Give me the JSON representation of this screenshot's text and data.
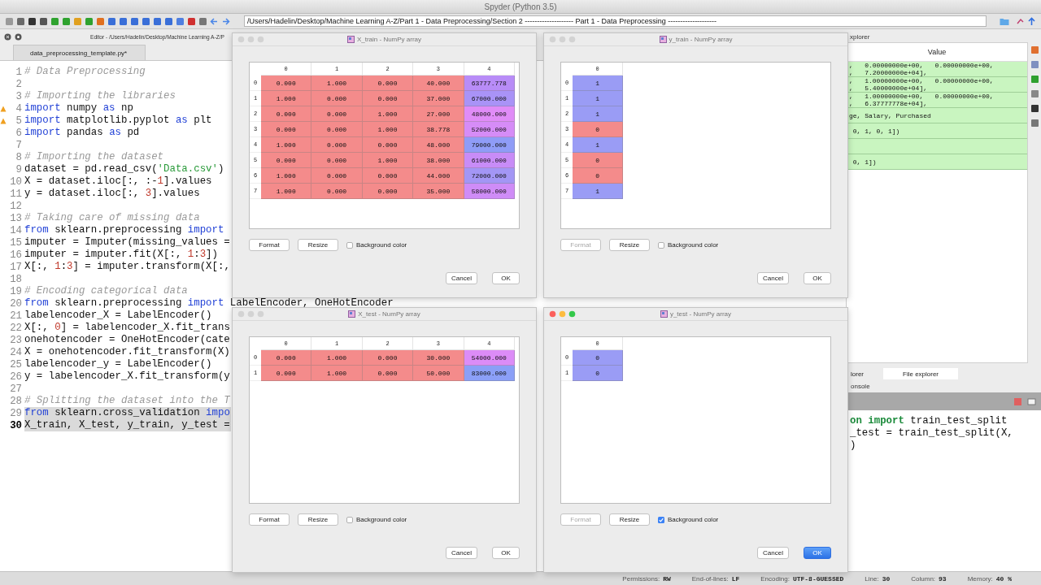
{
  "app": {
    "title": "Spyder (Python 3.5)",
    "path": "/Users/Hadelin/Desktop/Machine Learning A-Z/Part 1 - Data Preprocessing/Section 2 -------------------- Part 1 - Data Preprocessing --------------------"
  },
  "editor": {
    "header": "Editor - /Users/Hadelin/Desktop/Machine Learning A-Z/P",
    "tab": "data_preprocessing_template.py*",
    "lines": [
      {
        "number": "1",
        "warning": false,
        "highlighted": false,
        "current": false,
        "segments": [
          {
            "text": "# Data Preprocessing",
            "kind": "comment"
          }
        ]
      },
      {
        "number": "2",
        "warning": false,
        "highlighted": false,
        "current": false
      },
      {
        "number": "3",
        "warning": false,
        "highlighted": false,
        "current": false,
        "segments": [
          {
            "text": "# Importing the libraries",
            "kind": "comment"
          }
        ]
      },
      {
        "number": "4",
        "warning": true,
        "highlighted": false,
        "current": false,
        "segments": [
          {
            "text": "import",
            "kind": "keyword"
          },
          {
            "text": " numpy ",
            "kind": "plain"
          },
          {
            "text": "as",
            "kind": "keyword"
          },
          {
            "text": " np",
            "kind": "plain"
          }
        ]
      },
      {
        "number": "5",
        "warning": true,
        "highlighted": false,
        "current": false,
        "segments": [
          {
            "text": "import",
            "kind": "keyword"
          },
          {
            "text": " matplotlib.pyplot ",
            "kind": "plain"
          },
          {
            "text": "as",
            "kind": "keyword"
          },
          {
            "text": " plt",
            "kind": "plain"
          }
        ]
      },
      {
        "number": "6",
        "warning": false,
        "highlighted": false,
        "current": false,
        "segments": [
          {
            "text": "import",
            "kind": "keyword"
          },
          {
            "text": " pandas ",
            "kind": "plain"
          },
          {
            "text": "as",
            "kind": "keyword"
          },
          {
            "text": " pd",
            "kind": "plain"
          }
        ]
      },
      {
        "number": "7",
        "warning": false,
        "highlighted": false,
        "current": false
      },
      {
        "number": "8",
        "warning": false,
        "highlighted": false,
        "current": false,
        "segments": [
          {
            "text": "# Importing the dataset",
            "kind": "comment"
          }
        ]
      },
      {
        "number": "9",
        "warning": false,
        "highlighted": false,
        "current": false,
        "segments": [
          {
            "text": "dataset = pd.read_csv(",
            "kind": "plain"
          },
          {
            "text": "'Data.csv'",
            "kind": "string"
          },
          {
            "text": ")",
            "kind": "plain"
          }
        ]
      },
      {
        "number": "10",
        "warning": false,
        "highlighted": false,
        "current": false,
        "segments": [
          {
            "text": "X = dataset.iloc[:, :-",
            "kind": "plain"
          },
          {
            "text": "1",
            "kind": "number"
          },
          {
            "text": "].values",
            "kind": "plain"
          }
        ]
      },
      {
        "number": "11",
        "warning": false,
        "highlighted": false,
        "current": false,
        "segments": [
          {
            "text": "y = dataset.iloc[:, ",
            "kind": "plain"
          },
          {
            "text": "3",
            "kind": "number"
          },
          {
            "text": "].values",
            "kind": "plain"
          }
        ]
      },
      {
        "number": "12",
        "warning": false,
        "highlighted": false,
        "current": false
      },
      {
        "number": "13",
        "warning": false,
        "highlighted": false,
        "current": false,
        "segments": [
          {
            "text": "# Taking care of missing data",
            "kind": "comment"
          }
        ]
      },
      {
        "number": "14",
        "warning": false,
        "highlighted": false,
        "current": false,
        "segments": [
          {
            "text": "from",
            "kind": "keyword"
          },
          {
            "text": " sklearn.preprocessing ",
            "kind": "plain"
          },
          {
            "text": "import",
            "kind": "keyword"
          }
        ]
      },
      {
        "number": "15",
        "warning": false,
        "highlighted": false,
        "current": false,
        "segments": [
          {
            "text": "imputer = Imputer(missing_values =",
            "kind": "plain"
          }
        ]
      },
      {
        "number": "16",
        "warning": false,
        "highlighted": false,
        "current": false,
        "segments": [
          {
            "text": "imputer = imputer.fit(X[:, ",
            "kind": "plain"
          },
          {
            "text": "1",
            "kind": "number"
          },
          {
            "text": ":",
            "kind": "plain"
          },
          {
            "text": "3",
            "kind": "number"
          },
          {
            "text": "])",
            "kind": "plain"
          }
        ]
      },
      {
        "number": "17",
        "warning": false,
        "highlighted": false,
        "current": false,
        "segments": [
          {
            "text": "X[:, ",
            "kind": "plain"
          },
          {
            "text": "1",
            "kind": "number"
          },
          {
            "text": ":",
            "kind": "plain"
          },
          {
            "text": "3",
            "kind": "number"
          },
          {
            "text": "] = imputer.transform(X[:,",
            "kind": "plain"
          }
        ]
      },
      {
        "number": "18",
        "warning": false,
        "highlighted": false,
        "current": false
      },
      {
        "number": "19",
        "warning": false,
        "highlighted": false,
        "current": false,
        "segments": [
          {
            "text": "# Encoding categorical data",
            "kind": "comment"
          }
        ]
      },
      {
        "number": "20",
        "warning": false,
        "highlighted": false,
        "current": false,
        "segments": [
          {
            "text": "from",
            "kind": "keyword"
          },
          {
            "text": " sklearn.preprocessing ",
            "kind": "plain"
          },
          {
            "text": "import",
            "kind": "keyword"
          },
          {
            "text": " LabelEncoder, OneHotEncoder",
            "kind": "plain"
          }
        ]
      },
      {
        "number": "21",
        "warning": false,
        "highlighted": false,
        "current": false,
        "segments": [
          {
            "text": "labelencoder_X = LabelEncoder()",
            "kind": "plain"
          }
        ]
      },
      {
        "number": "22",
        "warning": false,
        "highlighted": false,
        "current": false,
        "segments": [
          {
            "text": "X[:, ",
            "kind": "plain"
          },
          {
            "text": "0",
            "kind": "number"
          },
          {
            "text": "] = labelencoder_X.fit_trans",
            "kind": "plain"
          }
        ]
      },
      {
        "number": "23",
        "warning": false,
        "highlighted": false,
        "current": false,
        "segments": [
          {
            "text": "onehotencoder = OneHotEncoder(cate",
            "kind": "plain"
          }
        ]
      },
      {
        "number": "24",
        "warning": false,
        "highlighted": false,
        "current": false,
        "segments": [
          {
            "text": "X = onehotencoder.fit_transform(X)",
            "kind": "plain"
          }
        ]
      },
      {
        "number": "25",
        "warning": false,
        "highlighted": false,
        "current": false,
        "segments": [
          {
            "text": "labelencoder_y = LabelEncoder()",
            "kind": "plain"
          }
        ]
      },
      {
        "number": "26",
        "warning": false,
        "highlighted": false,
        "current": false,
        "segments": [
          {
            "text": "y = labelencoder_X.fit_transform(y",
            "kind": "plain"
          }
        ]
      },
      {
        "number": "27",
        "warning": false,
        "highlighted": false,
        "current": false
      },
      {
        "number": "28",
        "warning": false,
        "highlighted": false,
        "current": false,
        "segments": [
          {
            "text": "# Splitting the dataset into the T",
            "kind": "comment"
          }
        ]
      },
      {
        "number": "29",
        "warning": false,
        "highlighted": true,
        "current": false,
        "segments": [
          {
            "text": "from",
            "kind": "keyword"
          },
          {
            "text": " sklearn.cross_validation ",
            "kind": "plain"
          },
          {
            "text": "impo",
            "kind": "keyword"
          }
        ]
      },
      {
        "number": "30",
        "warning": false,
        "highlighted": true,
        "current": true,
        "segments": [
          {
            "text": "X_train, X_test, y_train, y_test =",
            "kind": "plain"
          }
        ]
      }
    ]
  },
  "variable_explorer": {
    "header": "xplorer",
    "column": "Value",
    "rows": [
      {
        "lines": [
          ",   0.00000000e+00,   0.00000000e+00,",
          ",   7.20000000e+04],"
        ]
      },
      {
        "lines": [
          ",   1.00000000e+00,   0.00000000e+00,",
          ",   5.40000000e+04],"
        ]
      },
      {
        "lines": [
          ",   1.00000000e+00,   0.00000000e+00,",
          ",   6.37777778e+04],"
        ]
      },
      {
        "lines": [
          "ge, Salary, Purchased"
        ]
      },
      {
        "lines": [
          " 0, 1, 0, 1])"
        ]
      },
      {},
      {
        "lines": [
          " 0, 1])"
        ]
      }
    ]
  },
  "bottom_tabs": [
    {
      "label": "lorer",
      "selected": false
    },
    {
      "label": "File explorer",
      "selected": true
    }
  ],
  "console": {
    "header": "onsole",
    "lines": [
      {
        "segments": [
          {
            "text": "on import",
            "kind": "keyword"
          },
          {
            "text": " train_test_split",
            "kind": "plain"
          }
        ]
      },
      {
        "segments": [
          {
            "text": "_test = train_test_split(X,",
            "kind": "plain"
          }
        ]
      },
      {
        "segments": [
          {
            "text": ")",
            "kind": "plain"
          }
        ]
      }
    ]
  },
  "status_bar": [
    {
      "label": "Permissions:",
      "value": "RW"
    },
    {
      "label": "End-of-lines:",
      "value": "LF"
    },
    {
      "label": "Encoding:",
      "value": "UTF-8-GUESSED"
    },
    {
      "label": "Line:",
      "value": "30"
    },
    {
      "label": "Column:",
      "value": "93"
    },
    {
      "label": "Memory:",
      "value": "40 %"
    }
  ],
  "dialogs": [
    {
      "title": "X_train - NumPy array",
      "active": false,
      "columns": [
        "0",
        "1",
        "2",
        "3",
        "4"
      ],
      "rows": [
        {
          "index": "0",
          "cells": [
            {
              "text": "0.000",
              "color": "#f48b8b"
            },
            {
              "text": "1.000",
              "color": "#f48b8b"
            },
            {
              "text": "0.000",
              "color": "#f48b8b"
            },
            {
              "text": "40.000",
              "color": "#f48b8b"
            },
            {
              "text": "63777.778",
              "color": "#b88cf7"
            }
          ]
        },
        {
          "index": "1",
          "cells": [
            {
              "text": "1.000",
              "color": "#f48b8b"
            },
            {
              "text": "0.000",
              "color": "#f48b8b"
            },
            {
              "text": "0.000",
              "color": "#f48b8b"
            },
            {
              "text": "37.000",
              "color": "#f48b8b"
            },
            {
              "text": "67000.000",
              "color": "#a993f7"
            }
          ]
        },
        {
          "index": "2",
          "cells": [
            {
              "text": "0.000",
              "color": "#f48b8b"
            },
            {
              "text": "0.000",
              "color": "#f48b8b"
            },
            {
              "text": "1.000",
              "color": "#f48b8b"
            },
            {
              "text": "27.000",
              "color": "#f48b8b"
            },
            {
              "text": "48000.000",
              "color": "#e08cf7"
            }
          ]
        },
        {
          "index": "3",
          "cells": [
            {
              "text": "0.000",
              "color": "#f48b8b"
            },
            {
              "text": "0.000",
              "color": "#f48b8b"
            },
            {
              "text": "1.000",
              "color": "#f48b8b"
            },
            {
              "text": "38.778",
              "color": "#f48b8b"
            },
            {
              "text": "52000.000",
              "color": "#d68cf7"
            }
          ]
        },
        {
          "index": "4",
          "cells": [
            {
              "text": "1.000",
              "color": "#f48b8b"
            },
            {
              "text": "0.000",
              "color": "#f48b8b"
            },
            {
              "text": "0.000",
              "color": "#f48b8b"
            },
            {
              "text": "48.000",
              "color": "#f48b8b"
            },
            {
              "text": "79000.000",
              "color": "#8f9cf7"
            }
          ]
        },
        {
          "index": "5",
          "cells": [
            {
              "text": "0.000",
              "color": "#f48b8b"
            },
            {
              "text": "0.000",
              "color": "#f48b8b"
            },
            {
              "text": "1.000",
              "color": "#f48b8b"
            },
            {
              "text": "38.000",
              "color": "#f48b8b"
            },
            {
              "text": "61000.000",
              "color": "#c88cf7"
            }
          ]
        },
        {
          "index": "6",
          "cells": [
            {
              "text": "1.000",
              "color": "#f48b8b"
            },
            {
              "text": "0.000",
              "color": "#f48b8b"
            },
            {
              "text": "0.000",
              "color": "#f48b8b"
            },
            {
              "text": "44.000",
              "color": "#f48b8b"
            },
            {
              "text": "72000.000",
              "color": "#a396f5"
            }
          ]
        },
        {
          "index": "7",
          "cells": [
            {
              "text": "1.000",
              "color": "#f48b8b"
            },
            {
              "text": "0.000",
              "color": "#f48b8b"
            },
            {
              "text": "0.000",
              "color": "#f48b8b"
            },
            {
              "text": "35.000",
              "color": "#f48b8b"
            },
            {
              "text": "58000.000",
              "color": "#cf8cf7"
            }
          ]
        }
      ],
      "format": {
        "label": "Format",
        "disabled": false
      },
      "resize": "Resize",
      "background": {
        "label": "Background color",
        "checked": false
      },
      "cancel": "Cancel",
      "ok": {
        "label": "OK",
        "default": false
      }
    },
    {
      "title": "y_train - NumPy array",
      "active": false,
      "columns": [
        "0"
      ],
      "rows": [
        {
          "index": "0",
          "cells": [
            {
              "text": "1",
              "color": "#9a9cf5"
            }
          ]
        },
        {
          "index": "1",
          "cells": [
            {
              "text": "1",
              "color": "#9a9cf5"
            }
          ]
        },
        {
          "index": "2",
          "cells": [
            {
              "text": "1",
              "color": "#9a9cf5"
            }
          ]
        },
        {
          "index": "3",
          "cells": [
            {
              "text": "0",
              "color": "#f48b8b"
            }
          ]
        },
        {
          "index": "4",
          "cells": [
            {
              "text": "1",
              "color": "#9a9cf5"
            }
          ]
        },
        {
          "index": "5",
          "cells": [
            {
              "text": "0",
              "color": "#f48b8b"
            }
          ]
        },
        {
          "index": "6",
          "cells": [
            {
              "text": "0",
              "color": "#f48b8b"
            }
          ]
        },
        {
          "index": "7",
          "cells": [
            {
              "text": "1",
              "color": "#9a9cf5"
            }
          ]
        }
      ],
      "format": {
        "label": "Format",
        "disabled": true
      },
      "resize": "Resize",
      "background": {
        "label": "Background color",
        "checked": false
      },
      "cancel": "Cancel",
      "ok": {
        "label": "OK",
        "default": false
      }
    },
    {
      "title": "X_test - NumPy array",
      "active": false,
      "columns": [
        "0",
        "1",
        "2",
        "3",
        "4"
      ],
      "rows": [
        {
          "index": "0",
          "cells": [
            {
              "text": "0.000",
              "color": "#f48b8b"
            },
            {
              "text": "1.000",
              "color": "#f48b8b"
            },
            {
              "text": "0.000",
              "color": "#f48b8b"
            },
            {
              "text": "30.000",
              "color": "#f48b8b"
            },
            {
              "text": "54000.000",
              "color": "#dc8cf7"
            }
          ]
        },
        {
          "index": "1",
          "cells": [
            {
              "text": "0.000",
              "color": "#f48b8b"
            },
            {
              "text": "1.000",
              "color": "#f48b8b"
            },
            {
              "text": "0.000",
              "color": "#f48b8b"
            },
            {
              "text": "50.000",
              "color": "#f48b8b"
            },
            {
              "text": "83000.000",
              "color": "#8b9ff7"
            }
          ]
        }
      ],
      "format": {
        "label": "Format",
        "disabled": false
      },
      "resize": "Resize",
      "background": {
        "label": "Background color",
        "checked": false
      },
      "cancel": "Cancel",
      "ok": {
        "label": "OK",
        "default": false
      }
    },
    {
      "title": "y_test - NumPy array",
      "active": true,
      "columns": [
        "0"
      ],
      "rows": [
        {
          "index": "0",
          "cells": [
            {
              "text": "0",
              "color": "#9a9cf5"
            }
          ]
        },
        {
          "index": "1",
          "cells": [
            {
              "text": "0",
              "color": "#9a9cf5"
            }
          ]
        }
      ],
      "format": {
        "label": "Format",
        "disabled": true
      },
      "resize": "Resize",
      "background": {
        "label": "Background color",
        "checked": true
      },
      "cancel": "Cancel",
      "ok": {
        "label": "OK",
        "default": true
      }
    }
  ]
}
